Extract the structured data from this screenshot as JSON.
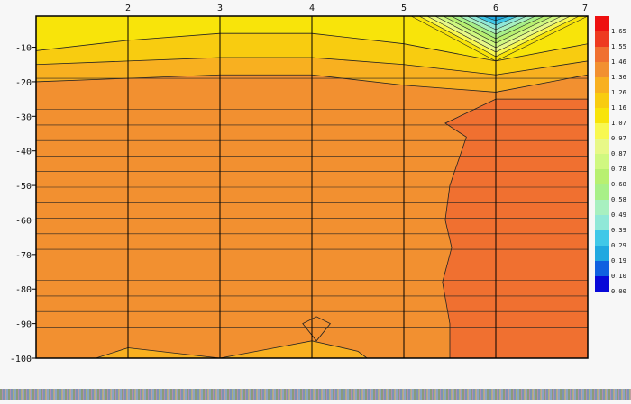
{
  "chart_data": {
    "type": "contour",
    "x_ticks": [
      "2",
      "3",
      "4",
      "5",
      "6",
      "7"
    ],
    "x_range": [
      1,
      7
    ],
    "y_ticks": [
      "-10",
      "-20",
      "-30",
      "-40",
      "-50",
      "-60",
      "-70",
      "-80",
      "-90",
      "-100"
    ],
    "y_range": [
      -1,
      -100
    ],
    "gridlines": "on",
    "legend_position": "right",
    "legend_levels": [
      "1.65",
      "1.55",
      "1.46",
      "1.36",
      "1.26",
      "1.16",
      "1.07",
      "0.97",
      "0.87",
      "0.78",
      "0.68",
      "0.58",
      "0.49",
      "0.39",
      "0.29",
      "0.19",
      "0.10",
      "0.00"
    ],
    "legend_colors": [
      "#ee1010",
      "#ee3a20",
      "#f07030",
      "#f29030",
      "#f8b020",
      "#f8cc10",
      "#f8e40a",
      "#f8f850",
      "#e8f888",
      "#d0f880",
      "#b8f070",
      "#a8f088",
      "#a8f0c0",
      "#90e8d8",
      "#40c8e8",
      "#20a8e0",
      "#1060e0",
      "#0808d8"
    ],
    "region_colors": {
      "top_band": "#f8e40a",
      "upper_transition": "#f8cc10",
      "transition_2": "#f8b020",
      "main": "#f29030",
      "deep_right": "#f07030",
      "bottom_pocket": "#f8b020"
    }
  }
}
